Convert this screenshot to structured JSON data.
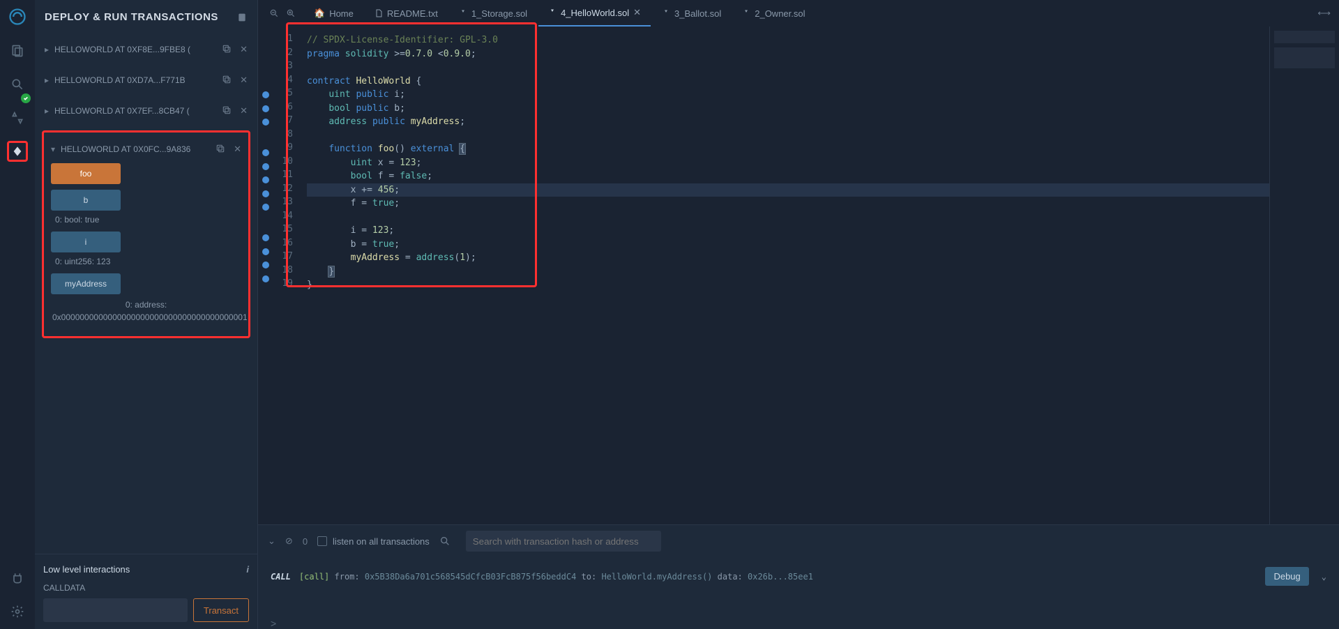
{
  "panel": {
    "title": "DEPLOY & RUN TRANSACTIONS"
  },
  "instances": [
    {
      "label": "HELLOWORLD AT 0XF8E...9FBE8 (",
      "open": false
    },
    {
      "label": "HELLOWORLD AT 0XD7A...F771B",
      "open": false
    },
    {
      "label": "HELLOWORLD AT 0X7EF...8CB47 (",
      "open": false
    },
    {
      "label": "HELLOWORLD AT 0X0FC...9A836",
      "open": true
    }
  ],
  "functions": {
    "foo": {
      "label": "foo",
      "kind": "orange"
    },
    "b": {
      "label": "b",
      "kind": "blue",
      "result": "0: bool: true"
    },
    "i": {
      "label": "i",
      "kind": "blue",
      "result": "0: uint256: 123"
    },
    "myAddress": {
      "label": "myAddress",
      "kind": "blue",
      "result": "0:  address: 0x0000000000000000000000000000000000000001"
    }
  },
  "lowlevel": {
    "title": "Low level interactions",
    "calldata": "CALLDATA",
    "transact": "Transact"
  },
  "tabs": [
    {
      "label": "Home",
      "icon": "home"
    },
    {
      "label": "README.txt",
      "icon": "file"
    },
    {
      "label": "1_Storage.sol",
      "icon": "sol"
    },
    {
      "label": "4_HelloWorld.sol",
      "icon": "sol",
      "active": true,
      "close": true
    },
    {
      "label": "3_Ballot.sol",
      "icon": "sol"
    },
    {
      "label": "2_Owner.sol",
      "icon": "sol"
    }
  ],
  "code_lines": [
    "// SPDX-License-Identifier: GPL-3.0",
    "pragma solidity >=0.7.0 <0.9.0;",
    "",
    "contract HelloWorld {",
    "    uint public i;",
    "    bool public b;",
    "    address public myAddress;",
    "",
    "    function foo() external {",
    "        uint x = 123;",
    "        bool f = false;",
    "        x += 456;",
    "        f = true;",
    "",
    "        i = 123;",
    "        b = true;",
    "        myAddress = address(1);",
    "    }",
    "}"
  ],
  "terminal": {
    "listen_label": "listen on all transactions",
    "search_placeholder": "Search with transaction hash or address",
    "pending_count": "0",
    "log": {
      "type": "CALL",
      "tag": "[call]",
      "from_label": "from:",
      "from": "0x5B38Da6a701c568545dCfcB03FcB875f56beddC4",
      "to_label": "to:",
      "to": "HelloWorld.myAddress()",
      "data_label": "data:",
      "data": "0x26b...85ee1"
    },
    "debug": "Debug",
    "prompt": ">"
  }
}
